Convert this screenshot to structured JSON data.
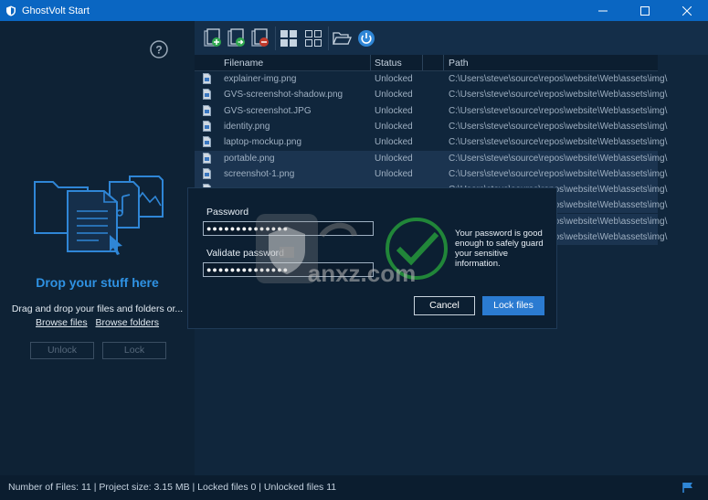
{
  "window": {
    "title": "GhostVolt Start",
    "accent": "#0a66c2",
    "icons": {
      "minimize": "minimize-icon",
      "maximize": "maximize-icon",
      "close": "close-icon"
    }
  },
  "left": {
    "help_icon": "help-circle-icon",
    "drop_title": "Drop your stuff here",
    "drop_desc": "Drag and drop your files and folders or...",
    "browse_files": "Browse files",
    "browse_folders": "Browse folders",
    "unlock_label": "Unlock",
    "lock_label": "Lock"
  },
  "toolbar": {
    "icons": [
      "add-files-icon",
      "add-folder-icon",
      "remove-icon",
      "large-grid-icon",
      "small-grid-icon",
      "open-folder-icon",
      "power-icon"
    ]
  },
  "files": {
    "columns": [
      "Filename",
      "Status",
      "Path"
    ],
    "rows": [
      {
        "name": "explainer-img.png",
        "status": "Unlocked",
        "path": "C:\\Users\\steve\\source\\repos\\website\\Web\\assets\\img\\"
      },
      {
        "name": "GVS-screenshot-shadow.png",
        "status": "Unlocked",
        "path": "C:\\Users\\steve\\source\\repos\\website\\Web\\assets\\img\\"
      },
      {
        "name": "GVS-screenshot.JPG",
        "status": "Unlocked",
        "path": "C:\\Users\\steve\\source\\repos\\website\\Web\\assets\\img\\"
      },
      {
        "name": "identity.png",
        "status": "Unlocked",
        "path": "C:\\Users\\steve\\source\\repos\\website\\Web\\assets\\img\\"
      },
      {
        "name": "laptop-mockup.png",
        "status": "Unlocked",
        "path": "C:\\Users\\steve\\source\\repos\\website\\Web\\assets\\img\\"
      },
      {
        "name": "portable.png",
        "status": "Unlocked",
        "path": "C:\\Users\\steve\\source\\repos\\website\\Web\\assets\\img\\"
      },
      {
        "name": "screenshot-1.png",
        "status": "Unlocked",
        "path": "C:\\Users\\steve\\source\\repos\\website\\Web\\assets\\img\\"
      },
      {
        "name": "",
        "status": "",
        "path": "C:\\Users\\steve\\source\\repos\\website\\Web\\assets\\img\\"
      },
      {
        "name": "",
        "status": "",
        "path": "C:\\Users\\steve\\source\\repos\\website\\Web\\assets\\img\\"
      },
      {
        "name": "",
        "status": "",
        "path": "C:\\Users\\steve\\source\\repos\\website\\Web\\assets\\img\\"
      },
      {
        "name": "",
        "status": "",
        "path": "C:\\Users\\steve\\source\\repos\\website\\Web\\assets\\img\\"
      }
    ]
  },
  "dialog": {
    "password_label": "Password",
    "password_value": "●●●●●●●●●●●●●●",
    "validate_label": "Validate password",
    "validate_value": "●●●●●●●●●●●●●●",
    "message": "Your password is good enough to safely guard your sensitive information.",
    "cancel_label": "Cancel",
    "lock_files_label": "Lock files",
    "button_color": "#2b7bd1"
  },
  "status": {
    "text": "Number of Files: 11 | Project size: 3.15 MB | Locked files 0 | Unlocked files 11",
    "flag_icon": "flag-icon"
  },
  "watermark": {
    "text": "anxz.com"
  }
}
